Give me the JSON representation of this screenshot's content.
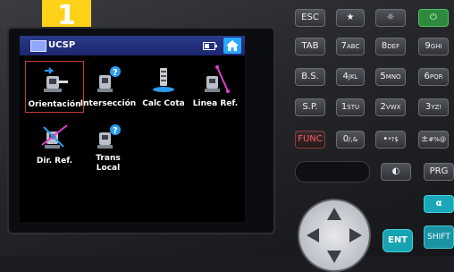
{
  "step_badge": "1",
  "screen": {
    "title": "UCSP",
    "menu": [
      {
        "label": "Orientación",
        "icon": "orientation-icon",
        "selected": true
      },
      {
        "label": "Intersección",
        "icon": "intersection-icon",
        "selected": false
      },
      {
        "label": "Calc Cota",
        "icon": "elevation-calc-icon",
        "selected": false
      },
      {
        "label": "Linea Ref.",
        "icon": "reference-line-icon",
        "selected": false
      },
      {
        "label": "Dir. Ref.",
        "icon": "reference-direction-icon",
        "selected": false
      },
      {
        "label_line1": "Trans",
        "label_line2": "Local",
        "icon": "local-transform-icon",
        "selected": false
      }
    ]
  },
  "keypad": {
    "esc": "ESC",
    "star": "★",
    "light": "☼",
    "power": "⏻",
    "tab": "TAB",
    "k7": "7",
    "k7sub": "ABC",
    "k8": "8",
    "k8sub": "DEF",
    "k9": "9",
    "k9sub": "GHI",
    "bs": "B.S.",
    "k4": "4",
    "k4sub": "JKL",
    "k5": "5",
    "k5sub": "MNO",
    "k6": "6",
    "k6sub": "PQR",
    "sp": "S.P.",
    "k1": "1",
    "k1sub": "STU",
    "k2": "2",
    "k2sub": "VWX",
    "k3": "3",
    "k3sub": "YZ!",
    "func": "FUNC",
    "k0": "0",
    "k0sub": "/,&",
    "dot": "•",
    "dotsub": "*?$",
    "pm": "±",
    "pmsub": "#%@",
    "target": "◐",
    "prg": "PRG",
    "alpha": "α",
    "ent": "ENT",
    "shift": "SHIFT"
  }
}
